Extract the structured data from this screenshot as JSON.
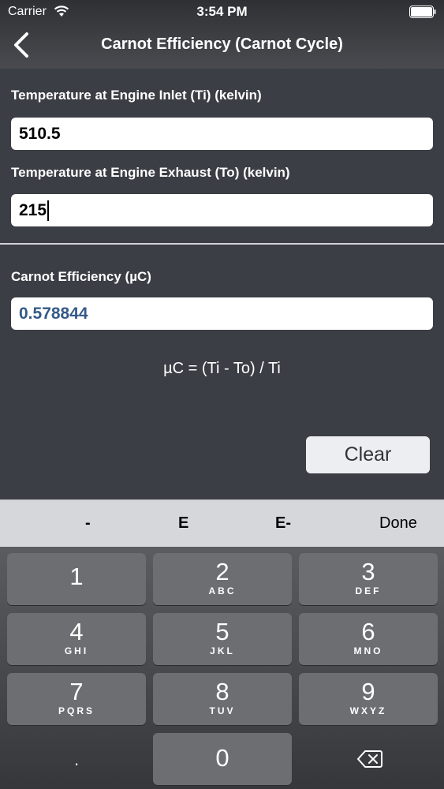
{
  "status_bar": {
    "carrier": "Carrier",
    "time": "3:54 PM"
  },
  "nav": {
    "back_icon": "chevron-left-icon",
    "title": "Carnot Efficiency (Carnot Cycle)"
  },
  "inputs": {
    "inlet": {
      "label": "Temperature at Engine Inlet (Ti) (kelvin)",
      "value": "510.5"
    },
    "exhaust": {
      "label": "Temperature at Engine Exhaust (To) (kelvin)",
      "value": "215"
    }
  },
  "result": {
    "label": "Carnot Efficiency (µC)",
    "value": "0.578844"
  },
  "formula": "µC = (Ti - To) / Ti",
  "clear_label": "Clear",
  "accessory": {
    "minus": "-",
    "e": "E",
    "e_minus": "E-",
    "done": "Done"
  },
  "keypad": {
    "k1": {
      "num": "1",
      "letters": ""
    },
    "k2": {
      "num": "2",
      "letters": "ABC"
    },
    "k3": {
      "num": "3",
      "letters": "DEF"
    },
    "k4": {
      "num": "4",
      "letters": "GHI"
    },
    "k5": {
      "num": "5",
      "letters": "JKL"
    },
    "k6": {
      "num": "6",
      "letters": "MNO"
    },
    "k7": {
      "num": "7",
      "letters": "PQRS"
    },
    "k8": {
      "num": "8",
      "letters": "TUV"
    },
    "k9": {
      "num": "9",
      "letters": "WXYZ"
    },
    "dot": ".",
    "k0": "0",
    "backspace_icon": "backspace-icon"
  }
}
